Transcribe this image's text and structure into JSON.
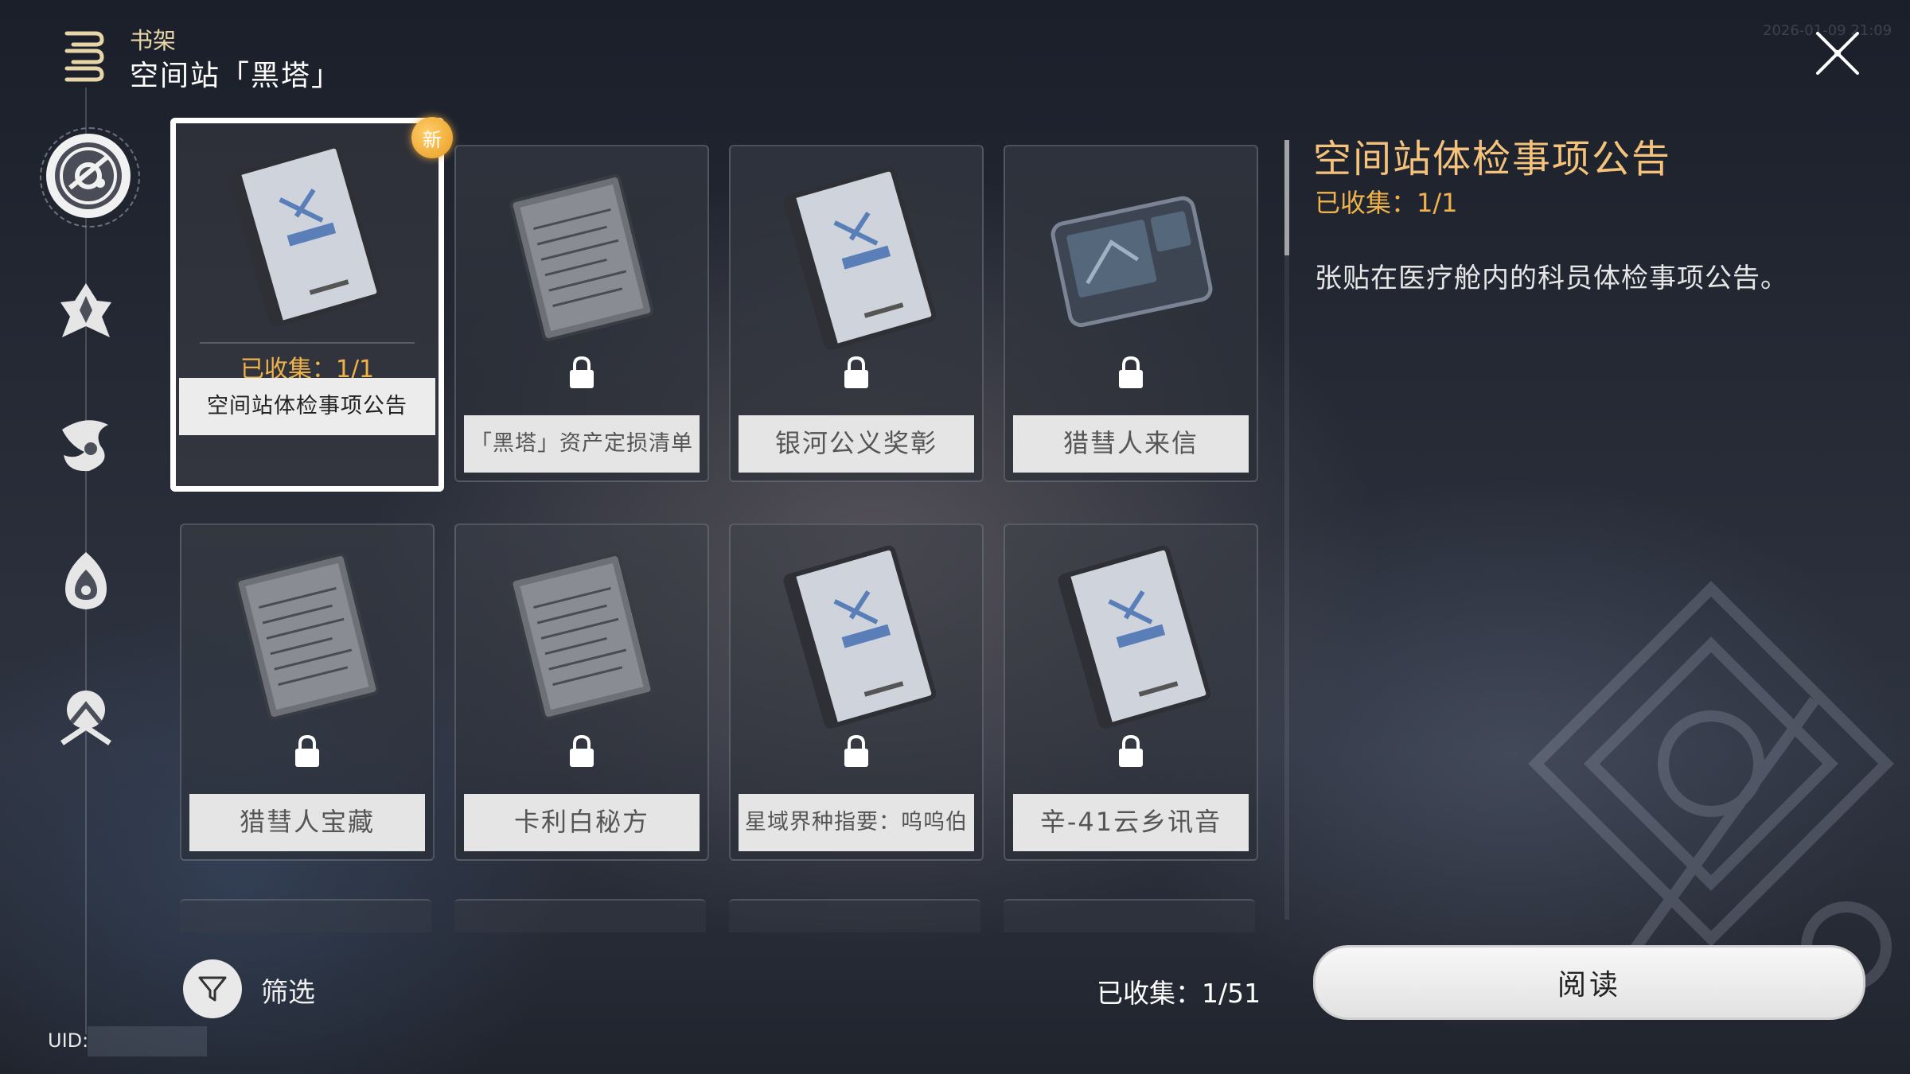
{
  "header": {
    "section": "书架",
    "title": "空间站「黑塔」",
    "timestamp": "2026-01-09 21:09"
  },
  "sidebar": {
    "items": [
      {
        "icon": "herta-space-station-icon",
        "active": true
      },
      {
        "icon": "jarilo-icon",
        "active": false
      },
      {
        "icon": "xianzhou-icon",
        "active": false
      },
      {
        "icon": "penacony-icon",
        "active": false
      },
      {
        "icon": "misc-world-icon",
        "active": false
      }
    ],
    "uid_label": "UID:"
  },
  "books": [
    {
      "title": "空间站体检事项公告",
      "locked": false,
      "collected": "已收集：1/1",
      "new_badge": "新",
      "art": "blue-notebook"
    },
    {
      "title": "「黑塔」资产定损清单",
      "locked": true,
      "art": "note-sheet"
    },
    {
      "title": "银河公义奖彰",
      "locked": true,
      "art": "blue-notebook"
    },
    {
      "title": "猎彗人来信",
      "locked": true,
      "art": "tablet"
    },
    {
      "title": "猎彗人宝藏",
      "locked": true,
      "art": "note-sheet"
    },
    {
      "title": "卡利白秘方",
      "locked": true,
      "art": "note-sheet"
    },
    {
      "title": "星域界种指要：呜呜伯",
      "locked": true,
      "art": "blue-notebook"
    },
    {
      "title": "辛-41云乡讯音",
      "locked": true,
      "art": "blue-notebook"
    }
  ],
  "detail": {
    "title": "空间站体检事项公告",
    "collected": "已收集：1/1",
    "description": "张贴在医疗舱内的科员体检事项公告。"
  },
  "footer": {
    "filter_label": "筛选",
    "total_collected": "已收集：1/51",
    "read_button": "阅读"
  },
  "colors": {
    "accent_gold": "#f0b24a",
    "title_gold": "#f4c27a",
    "new_badge": "#e89b22"
  }
}
